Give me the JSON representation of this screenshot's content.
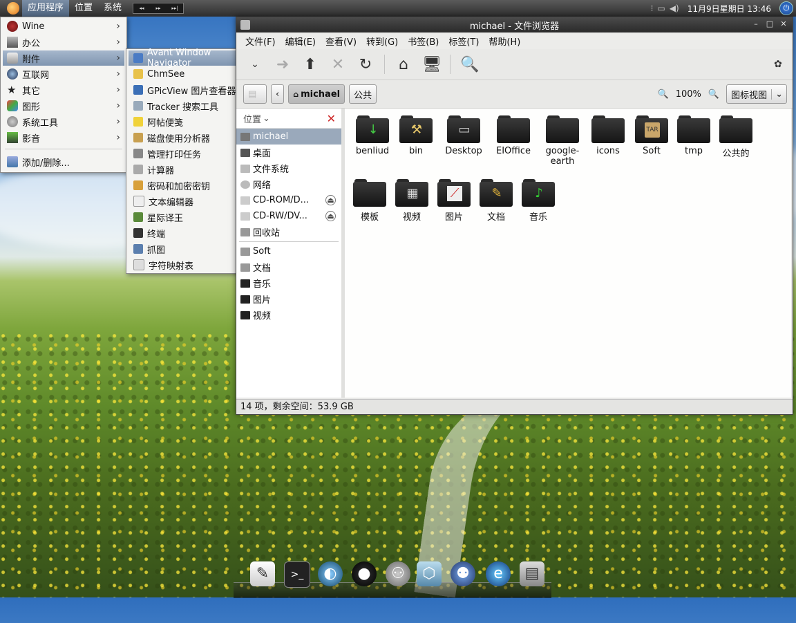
{
  "top_panel": {
    "menus": [
      "应用程序",
      "位置",
      "系统"
    ],
    "clock": "11月9日星期日 13:46"
  },
  "app_menu": {
    "items": [
      {
        "label": "Wine",
        "icon": "wine-icon"
      },
      {
        "label": "办公",
        "icon": "office-icon"
      },
      {
        "label": "附件",
        "icon": "accessories-icon"
      },
      {
        "label": "互联网",
        "icon": "internet-icon"
      },
      {
        "label": "其它",
        "icon": "other-icon"
      },
      {
        "label": "图形",
        "icon": "graphics-icon"
      },
      {
        "label": "系统工具",
        "icon": "system-tools-icon"
      },
      {
        "label": "影音",
        "icon": "multimedia-icon"
      }
    ],
    "add_remove": "添加/删除..."
  },
  "submenu": {
    "items": [
      "Avant Window Navigator",
      "ChmSee",
      "GPicView 图片查看器",
      "Tracker 搜索工具",
      "阿帖便笺",
      "磁盘使用分析器",
      "管理打印任务",
      "计算器",
      "密码和加密密钥",
      "文本编辑器",
      "星际译王",
      "终端",
      "抓图",
      "字符映射表"
    ]
  },
  "file_manager": {
    "title": "michael - 文件浏览器",
    "menubar": [
      "文件(F)",
      "编辑(E)",
      "查看(V)",
      "转到(G)",
      "书签(B)",
      "标签(T)",
      "帮助(H)"
    ],
    "path_buttons": [
      "michael",
      "公共"
    ],
    "zoom": "100%",
    "view_mode": "图标视图",
    "sidebar_header": "位置",
    "sidebar_items": [
      "michael",
      "桌面",
      "文件系统",
      "网络",
      "CD-ROM/D...",
      "CD-RW/DV...",
      "回收站"
    ],
    "bookmarks": [
      "Soft",
      "文档",
      "音乐",
      "图片",
      "视频"
    ],
    "files": [
      {
        "name": "benliud",
        "emblem": "↓"
      },
      {
        "name": "bin",
        "emblem": "⚒"
      },
      {
        "name": "Desktop",
        "emblem": "▭"
      },
      {
        "name": "EIOffice",
        "emblem": ""
      },
      {
        "name": "google-earth",
        "emblem": ""
      },
      {
        "name": "icons",
        "emblem": ""
      },
      {
        "name": "Soft",
        "emblem": "TAR"
      },
      {
        "name": "tmp",
        "emblem": ""
      },
      {
        "name": "公共的",
        "emblem": ""
      },
      {
        "name": "模板",
        "emblem": ""
      },
      {
        "name": "视频",
        "emblem": "▦"
      },
      {
        "name": "图片",
        "emblem": "⟋"
      },
      {
        "name": "文档",
        "emblem": "✎"
      },
      {
        "name": "音乐",
        "emblem": "♪"
      }
    ],
    "status": "14 项，剩余空间：53.9 GB"
  },
  "dock": [
    "text-editor-icon",
    "terminal-icon",
    "browser-globe-icon",
    "qq-penguin-icon",
    "messenger-icon",
    "virtualbox-icon",
    "chat-icon",
    "ie-icon",
    "file-cabinet-icon"
  ]
}
